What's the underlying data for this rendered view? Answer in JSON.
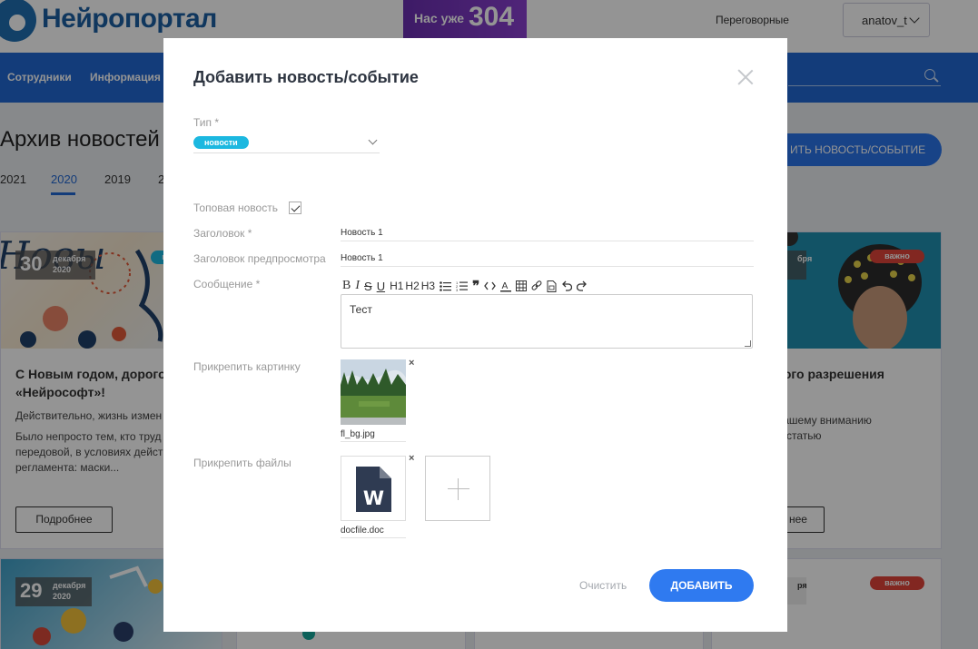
{
  "header": {
    "logo_text": "Нейропортал",
    "counter_label": "Нас уже",
    "counter_value": "304",
    "meeting_rooms": "Переговорные",
    "username": "anatov_t"
  },
  "nav": {
    "items": [
      "Сотрудники",
      "Информация"
    ]
  },
  "archive": {
    "title": "Архив новостей",
    "add_button": "ИТЬ НОВОСТЬ/СОБЫТИЕ",
    "years": [
      "2021",
      "2020",
      "2019",
      "2"
    ],
    "active_year": "2020"
  },
  "cards": [
    {
      "day": "30",
      "month": "декабря",
      "year": "2020",
      "badge": "н",
      "title_lines": [
        "С Новым годом, дорогой",
        "«Нейрософт»!"
      ],
      "text_lines": [
        "Действительно, жизнь измен",
        "Было непросто тем, кто труд",
        "передовой, в условиях дейст",
        "регламента: маски..."
      ],
      "button": "Подробнее"
    },
    {
      "day": "",
      "month": "бря",
      "year": "",
      "badge": "важно",
      "title_lines": [
        "кого разрешения"
      ],
      "text_lines": [
        "т!",
        "вашему вниманию",
        "о статью"
      ],
      "button": "нее"
    },
    {
      "day": "29",
      "month": "декабря",
      "year": "2020",
      "badge": "",
      "title_lines": [],
      "text_lines": [],
      "button": ""
    },
    {
      "day": "",
      "month": "ря",
      "year": "",
      "badge": "важно",
      "title_lines": [],
      "text_lines": [],
      "button": ""
    }
  ],
  "modal": {
    "title": "Добавить новость/событие",
    "type_label": "Тип *",
    "type_value": "новости",
    "top_news_label": "Топовая новость",
    "top_news_checked": true,
    "headline_label": "Заголовок *",
    "headline_value": "Новость 1",
    "preview_label": "Заголовок предпросмотра",
    "preview_value": "Новость 1",
    "message_label": "Сообщение *",
    "toolbar": [
      "bold",
      "italic",
      "strikethrough",
      "underline",
      "H1",
      "H2",
      "H3",
      "bullet-list",
      "numbered-list",
      "quote",
      "code",
      "text-color",
      "table",
      "link",
      "file",
      "undo",
      "redo"
    ],
    "message_value": "Тест",
    "image_label": "Прикрепить картинку",
    "image_file": "fl_bg.jpg",
    "files_label": "Прикрепить файлы",
    "attached_file": "docfile.doc",
    "file_icon_letter": "W",
    "remove_symbol": "×",
    "clear_button": "Очистить",
    "submit_button": "ДОБАВИТЬ"
  },
  "colors": {
    "brand_blue": "#2268d2",
    "button_blue": "#2f7af0",
    "tag_cyan": "#1cb8e0",
    "important_red": "#e0443a",
    "counter_purple": "#6a2fb0",
    "word_icon": "#2f3b52"
  }
}
